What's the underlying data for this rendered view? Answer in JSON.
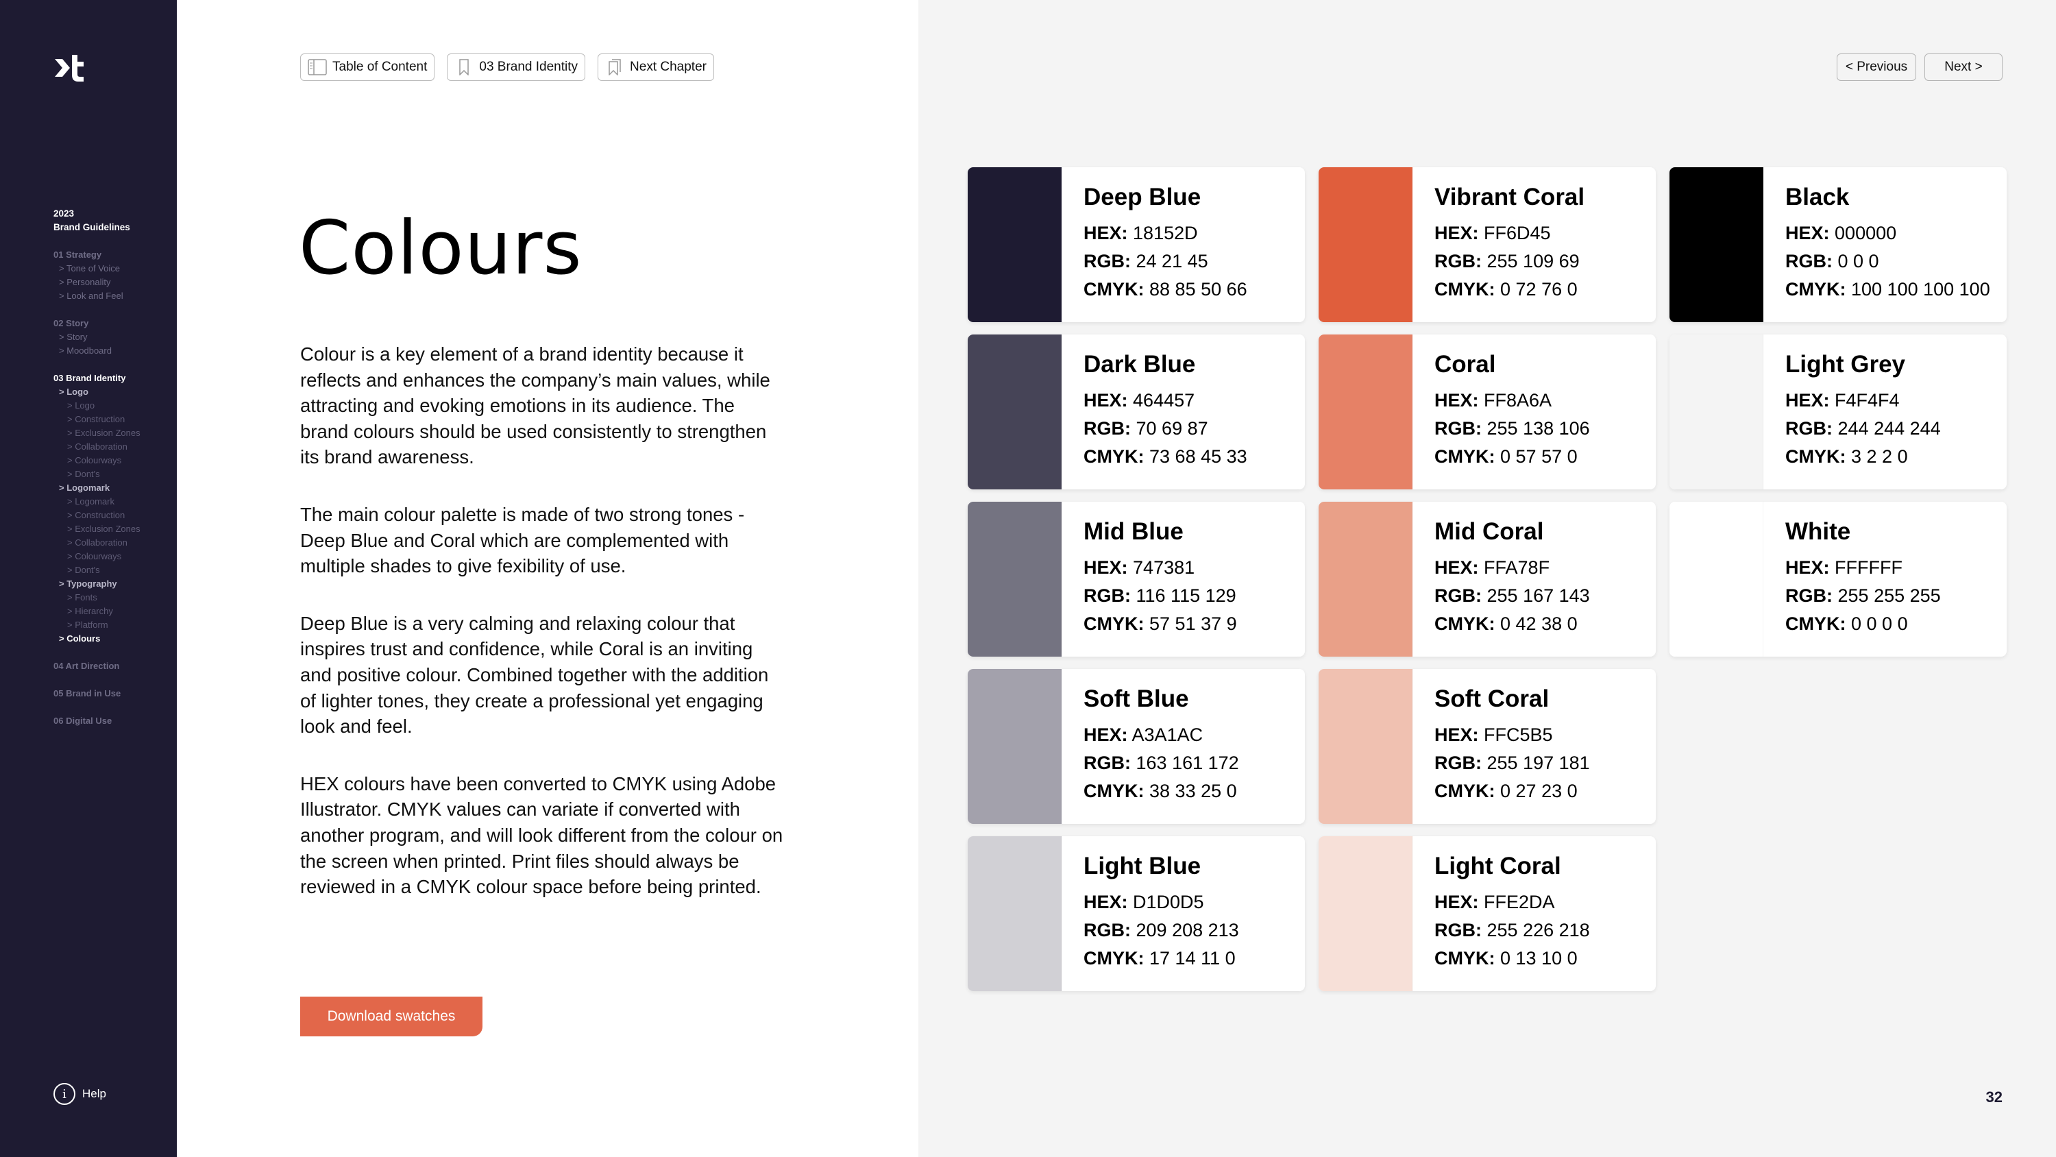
{
  "sidebar": {
    "logo": "xt",
    "year": "2023",
    "subtitle": "Brand Guidelines",
    "sections": [
      {
        "label": "01 Strategy",
        "active": false,
        "items": [
          {
            "label": "> Tone of Voice",
            "level": 1
          },
          {
            "label": "> Personality",
            "level": 1
          },
          {
            "label": "> Look and Feel",
            "level": 1
          }
        ]
      },
      {
        "label": "02 Story",
        "active": false,
        "items": [
          {
            "label": "> Story",
            "level": 1
          },
          {
            "label": "> Moodboard",
            "level": 1
          }
        ]
      },
      {
        "label": "03 Brand Identity",
        "active": true,
        "items": [
          {
            "label": "> Logo",
            "level": 1,
            "bright": true
          },
          {
            "label": "> Logo",
            "level": 2
          },
          {
            "label": "> Construction",
            "level": 2
          },
          {
            "label": "> Exclusion Zones",
            "level": 2
          },
          {
            "label": "> Collaboration",
            "level": 2
          },
          {
            "label": "> Colourways",
            "level": 2
          },
          {
            "label": "> Dont's",
            "level": 2
          },
          {
            "label": "> Logomark",
            "level": 1,
            "bright": true
          },
          {
            "label": "> Logomark",
            "level": 2
          },
          {
            "label": "> Construction",
            "level": 2
          },
          {
            "label": "> Exclusion Zones",
            "level": 2
          },
          {
            "label": "> Collaboration",
            "level": 2
          },
          {
            "label": "> Colourways",
            "level": 2
          },
          {
            "label": "> Dont's",
            "level": 2
          },
          {
            "label": "> Typography",
            "level": 1,
            "bright": true
          },
          {
            "label": "> Fonts",
            "level": 2
          },
          {
            "label": "> Hierarchy",
            "level": 2
          },
          {
            "label": "> Platform",
            "level": 2
          },
          {
            "label": "> Colours",
            "level": 1,
            "current": true
          }
        ]
      },
      {
        "label": "04 Art Direction",
        "active": false,
        "items": []
      },
      {
        "label": "05 Brand in Use",
        "active": false,
        "items": []
      },
      {
        "label": "06 Digital Use",
        "active": false,
        "items": []
      }
    ],
    "help_label": "Help"
  },
  "toolbar": {
    "toc_label": "Table of Content",
    "chapter_label": "03 Brand Identity",
    "next_chapter_label": "Next Chapter"
  },
  "page": {
    "title": "Colours",
    "paragraphs": [
      "Colour is a key element of a brand identity because it reflects and enhances the company’s main values, while attracting and evoking emotions in its audience. The brand colours should be used consistently to strengthen its brand awareness.",
      "The main colour palette is made of two strong tones - Deep Blue and Coral which are complemented with multiple shades to give fexibility of use.",
      "Deep Blue is a very calming and relaxing colour that inspires trust and confidence, while Coral is an inviting and positive colour. Combined together with the addition of lighter tones, they create a professional yet engaging look and feel.",
      "HEX colours have been converted to CMYK using Adobe Illustrator. CMYK values can variate if converted with another program, and will look different from the colour on the screen when printed. Print files should always be reviewed in a CMYK colour space before being printed."
    ],
    "download_label": "Download swatches",
    "accent_color": "#e2674a"
  },
  "pagination": {
    "previous_label": "< Previous",
    "next_label": "Next >",
    "page_number": "32"
  },
  "labels": {
    "hex": "HEX:",
    "rgb": "RGB:",
    "cmyk": "CMYK:"
  },
  "swatches": [
    {
      "name": "Deep Blue",
      "hex": "18152D",
      "rgb": "24 21 45",
      "cmyk": "88 85 50 66",
      "display": "#1e1b32",
      "col": 1,
      "row": 1
    },
    {
      "name": "Vibrant Coral",
      "hex": "FF6D45",
      "rgb": "255 109 69",
      "cmyk": "0 72 76 0",
      "display": "#e05e3c",
      "col": 2,
      "row": 1
    },
    {
      "name": "Black",
      "hex": "000000",
      "rgb": "0 0 0",
      "cmyk": "100 100 100 100",
      "display": "#000000",
      "col": 3,
      "row": 1
    },
    {
      "name": "Dark Blue",
      "hex": "464457",
      "rgb": "70 69 87",
      "cmyk": "73 68 45 33",
      "display": "#464457",
      "col": 1,
      "row": 2
    },
    {
      "name": "Coral",
      "hex": "FF8A6A",
      "rgb": "255 138 106",
      "cmyk": "0 57 57 0",
      "display": "#e68166",
      "col": 2,
      "row": 2
    },
    {
      "name": "Light Grey",
      "hex": "F4F4F4",
      "rgb": "244 244 244",
      "cmyk": "3 2 2 0",
      "display": "#f4f4f4",
      "col": 3,
      "row": 2
    },
    {
      "name": "Mid Blue",
      "hex": "747381",
      "rgb": "116 115 129",
      "cmyk": "57 51 37 9",
      "display": "#747381",
      "col": 1,
      "row": 3
    },
    {
      "name": "Mid Coral",
      "hex": "FFA78F",
      "rgb": "255 167 143",
      "cmyk": "0 42 38 0",
      "display": "#e9a088",
      "col": 2,
      "row": 3
    },
    {
      "name": "White",
      "hex": "FFFFFF",
      "rgb": "255 255 255",
      "cmyk": "0 0 0 0",
      "display": "#ffffff",
      "col": 3,
      "row": 3
    },
    {
      "name": "Soft Blue",
      "hex": "A3A1AC",
      "rgb": "163 161 172",
      "cmyk": "38 33 25 0",
      "display": "#a3a1ac",
      "col": 1,
      "row": 4
    },
    {
      "name": "Soft Coral",
      "hex": "FFC5B5",
      "rgb": "255 197 181",
      "cmyk": "0 27 23 0",
      "display": "#f0c1b1",
      "col": 2,
      "row": 4
    },
    {
      "name": "Light Blue",
      "hex": "D1D0D5",
      "rgb": "209 208 213",
      "cmyk": "17 14 11 0",
      "display": "#d1d0d5",
      "col": 1,
      "row": 5
    },
    {
      "name": "Light Coral",
      "hex": "FFE2DA",
      "rgb": "255 226 218",
      "cmyk": "0 13 10 0",
      "display": "#f7e0d8",
      "col": 2,
      "row": 5
    }
  ]
}
